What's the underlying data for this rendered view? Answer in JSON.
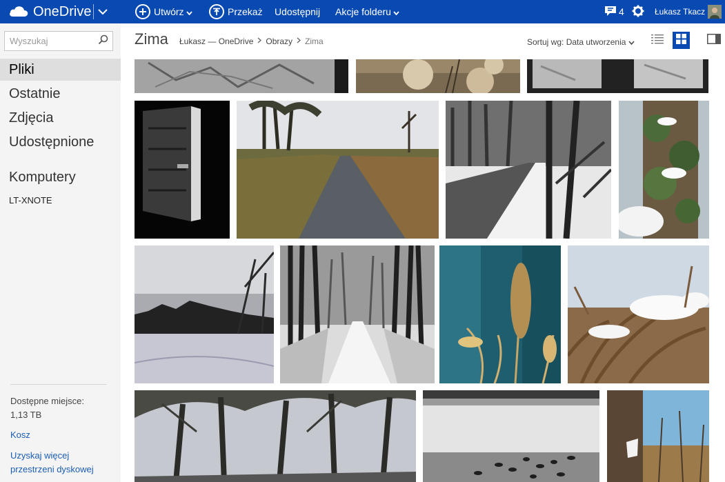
{
  "topbar": {
    "app_name": "OneDrive",
    "create_label": "Utwórz",
    "upload_label": "Przekaż",
    "share_label": "Udostępnij",
    "folder_actions_label": "Akcje folderu",
    "notifications_count": "4",
    "user_name": "Łukasz Tkacz"
  },
  "sidebar": {
    "search_placeholder": "Wyszukaj",
    "nav": [
      {
        "label": "Pliki"
      },
      {
        "label": "Ostatnie"
      },
      {
        "label": "Zdjęcia"
      },
      {
        "label": "Udostępnione"
      },
      {
        "label": "Komputery"
      }
    ],
    "device": "LT-XNOTE",
    "quota_label": "Dostępne miejsce:",
    "quota_value": "1,13 TB",
    "trash_label": "Kosz",
    "more_storage_line1": "Uzyskaj więcej",
    "more_storage_line2": "przestrzeni dyskowej"
  },
  "header": {
    "folder_title": "Zima",
    "breadcrumb": [
      "Łukasz — OneDrive",
      "Obrazy",
      "Zima"
    ],
    "sort_label": "Sortuj wg: Data utworzenia"
  },
  "colors": {
    "brand": "#094ab2",
    "link": "#1a5db5",
    "sidebar_bg": "#f4f4f4",
    "active_nav_bg": "#dedede"
  }
}
